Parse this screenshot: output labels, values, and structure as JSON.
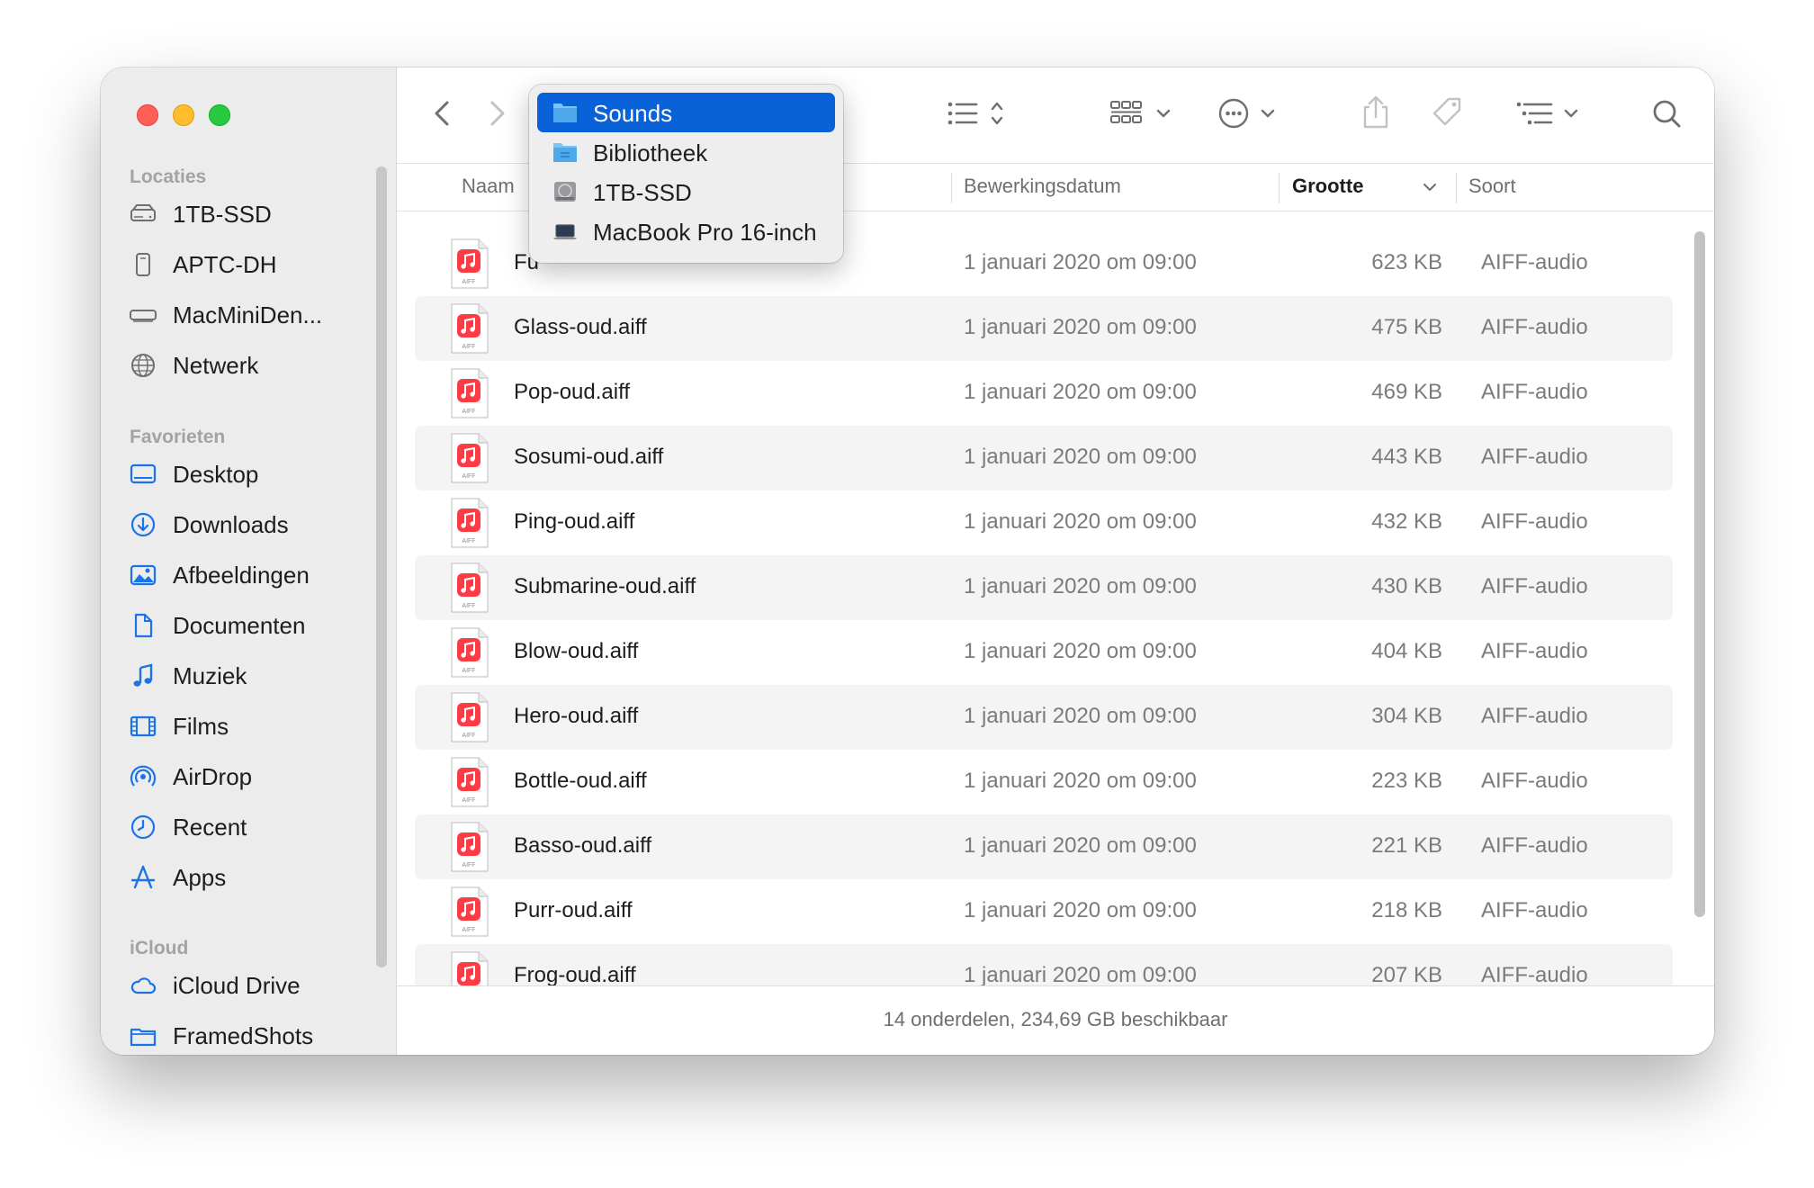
{
  "window": {
    "traffic_lights": {
      "close": "#fe5f57",
      "minimize": "#febc2e",
      "zoom": "#28c840"
    }
  },
  "sidebar": {
    "sections": [
      {
        "title": "Locaties",
        "items": [
          {
            "label": "1TB-SSD",
            "icon": "internal-drive-icon"
          },
          {
            "label": "APTC-DH",
            "icon": "external-drive-icon"
          },
          {
            "label": "MacMiniDen...",
            "icon": "mac-mini-icon"
          },
          {
            "label": "Netwerk",
            "icon": "network-globe-icon"
          }
        ]
      },
      {
        "title": "Favorieten",
        "items": [
          {
            "label": "Desktop",
            "icon": "desktop-icon"
          },
          {
            "label": "Downloads",
            "icon": "downloads-icon"
          },
          {
            "label": "Afbeeldingen",
            "icon": "pictures-icon"
          },
          {
            "label": "Documenten",
            "icon": "document-icon"
          },
          {
            "label": "Muziek",
            "icon": "music-note-icon"
          },
          {
            "label": "Films",
            "icon": "film-icon"
          },
          {
            "label": "AirDrop",
            "icon": "airdrop-icon"
          },
          {
            "label": "Recent",
            "icon": "clock-icon"
          },
          {
            "label": "Apps",
            "icon": "apps-icon"
          }
        ]
      },
      {
        "title": "iCloud",
        "items": [
          {
            "label": "iCloud Drive",
            "icon": "cloud-icon"
          },
          {
            "label": "FramedShots",
            "icon": "folder-icon"
          }
        ]
      }
    ]
  },
  "toolbar": {
    "icons": [
      "back-icon",
      "forward-icon",
      "list-view-icon",
      "group-icon",
      "more-icon",
      "share-icon",
      "tag-icon",
      "sort-icon",
      "search-icon"
    ]
  },
  "path_popup": {
    "items": [
      {
        "label": "Sounds",
        "icon": "folder-icon",
        "selected": true
      },
      {
        "label": "Bibliotheek",
        "icon": "folder-icon",
        "selected": false
      },
      {
        "label": "1TB-SSD",
        "icon": "internal-drive-icon",
        "selected": false
      },
      {
        "label": "MacBook Pro 16-inch",
        "icon": "laptop-icon",
        "selected": false
      }
    ]
  },
  "columns": {
    "name": "Naam",
    "date": "Bewerkingsdatum",
    "size": "Grootte",
    "kind": "Soort"
  },
  "files": [
    {
      "name": "Fu",
      "date": "1 januari 2020 om 09:00",
      "size": "623 KB",
      "kind": "AIFF-audio"
    },
    {
      "name": "Glass-oud.aiff",
      "date": "1 januari 2020 om 09:00",
      "size": "475 KB",
      "kind": "AIFF-audio"
    },
    {
      "name": "Pop-oud.aiff",
      "date": "1 januari 2020 om 09:00",
      "size": "469 KB",
      "kind": "AIFF-audio"
    },
    {
      "name": "Sosumi-oud.aiff",
      "date": "1 januari 2020 om 09:00",
      "size": "443 KB",
      "kind": "AIFF-audio"
    },
    {
      "name": "Ping-oud.aiff",
      "date": "1 januari 2020 om 09:00",
      "size": "432 KB",
      "kind": "AIFF-audio"
    },
    {
      "name": "Submarine-oud.aiff",
      "date": "1 januari 2020 om 09:00",
      "size": "430 KB",
      "kind": "AIFF-audio"
    },
    {
      "name": "Blow-oud.aiff",
      "date": "1 januari 2020 om 09:00",
      "size": "404 KB",
      "kind": "AIFF-audio"
    },
    {
      "name": "Hero-oud.aiff",
      "date": "1 januari 2020 om 09:00",
      "size": "304 KB",
      "kind": "AIFF-audio"
    },
    {
      "name": "Bottle-oud.aiff",
      "date": "1 januari 2020 om 09:00",
      "size": "223 KB",
      "kind": "AIFF-audio"
    },
    {
      "name": "Basso-oud.aiff",
      "date": "1 januari 2020 om 09:00",
      "size": "221 KB",
      "kind": "AIFF-audio"
    },
    {
      "name": "Purr-oud.aiff",
      "date": "1 januari 2020 om 09:00",
      "size": "218 KB",
      "kind": "AIFF-audio"
    },
    {
      "name": "Frog-oud.aiff",
      "date": "1 januari 2020 om 09:00",
      "size": "207 KB",
      "kind": "AIFF-audio"
    }
  ],
  "file_icon_badge": "AIFF",
  "status": {
    "text": "14 onderdelen, 234,69 GB beschikbaar"
  },
  "colors": {
    "accent": "#0962d8",
    "sidebar_icon": "#1a73e8",
    "aiff_red": "#fc3c44"
  }
}
